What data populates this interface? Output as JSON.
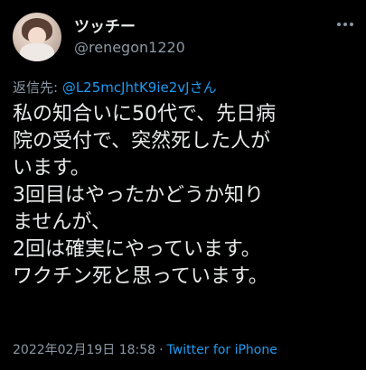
{
  "user": {
    "display_name": "ツッチー",
    "handle": "@renegon1220"
  },
  "reply": {
    "label": "返信先: ",
    "target": "@L25mcJhtK9ie2vJさん"
  },
  "tweet": {
    "lines": [
      "私の知合いに50代で、先日病",
      "院の受付で、突然死した人が",
      "います。",
      "3回目はやったかどうか知り",
      "ませんが、",
      "2回は確実にやっています。",
      "ワクチン死と思っています。"
    ]
  },
  "meta": {
    "timestamp": "2022年02月19日 18:58",
    "separator": "·",
    "source": "Twitter for iPhone"
  },
  "icons": {
    "more": "more-horizontal-icon"
  },
  "colors": {
    "background": "#000000",
    "text": "#e7e9ea",
    "secondary": "#8b98a5",
    "accent": "#1d9bf0"
  }
}
